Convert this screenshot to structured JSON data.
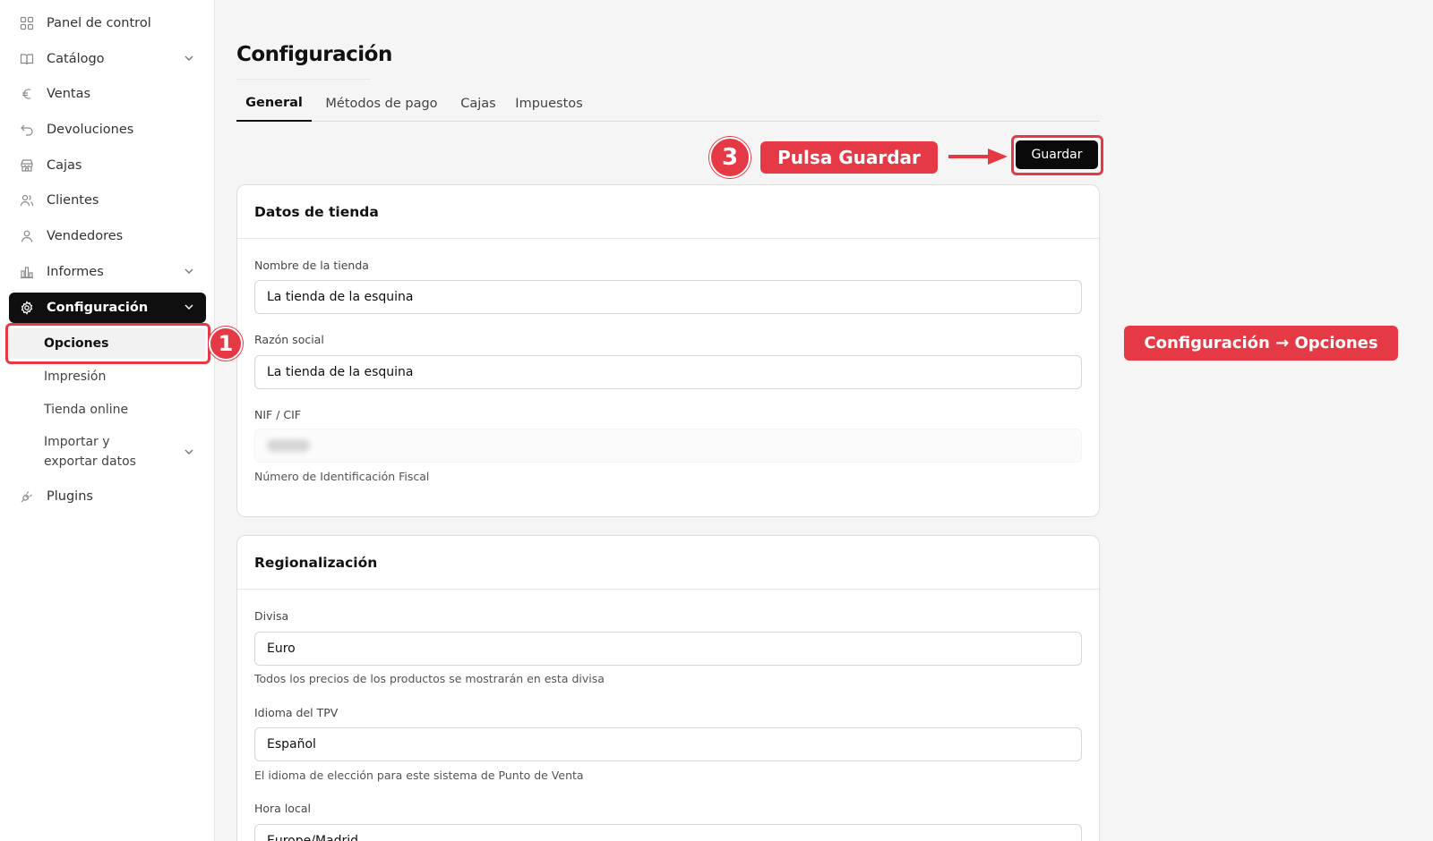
{
  "sidebar": {
    "items": [
      {
        "label": "Panel de control",
        "icon": "dashboard-grid-icon"
      },
      {
        "label": "Catálogo",
        "icon": "book-icon",
        "has_children": true
      },
      {
        "label": "Ventas",
        "icon": "euro-icon"
      },
      {
        "label": "Devoluciones",
        "icon": "return-arrow-icon"
      },
      {
        "label": "Cajas",
        "icon": "store-icon"
      },
      {
        "label": "Clientes",
        "icon": "users-icon"
      },
      {
        "label": "Vendedores",
        "icon": "user-icon"
      },
      {
        "label": "Informes",
        "icon": "bar-chart-icon",
        "has_children": true
      },
      {
        "label": "Configuración",
        "icon": "gear-icon",
        "has_children": true,
        "active": true
      }
    ],
    "config_subitems": [
      {
        "label": "Opciones",
        "selected": true
      },
      {
        "label": "Impresión"
      },
      {
        "label": "Tienda online"
      },
      {
        "label": "Importar y exportar datos",
        "has_children": true
      }
    ],
    "plugins": {
      "label": "Plugins",
      "icon": "plug-icon"
    }
  },
  "page": {
    "title": "Configuración",
    "tabs": [
      {
        "label": "General",
        "active": true
      },
      {
        "label": "Métodos de pago"
      },
      {
        "label": "Cajas"
      },
      {
        "label": "Impuestos"
      }
    ],
    "save_label": "Guardar"
  },
  "store_card": {
    "title": "Datos de tienda",
    "name_label": "Nombre de la tienda",
    "name_value": "La tienda de la esquina",
    "legal_label": "Razón social",
    "legal_value": "La tienda de la esquina",
    "nif_label": "NIF / CIF",
    "nif_help": "Número de Identificación Fiscal"
  },
  "region_card": {
    "title": "Regionalización",
    "currency_label": "Divisa",
    "currency_value": "Euro",
    "currency_help": "Todos los precios de los productos se mostrarán en esta divisa",
    "language_label": "Idioma del TPV",
    "language_value": "Español",
    "language_help": "El idioma de elección para este sistema de Punto de Venta",
    "time_label": "Hora local",
    "time_value": "Europe/Madrid"
  },
  "annotations": {
    "step1": "1",
    "step3": "3",
    "save_callout": "Pulsa Guardar",
    "config_callout": "Configuración → Opciones",
    "accent": "#e63946"
  }
}
